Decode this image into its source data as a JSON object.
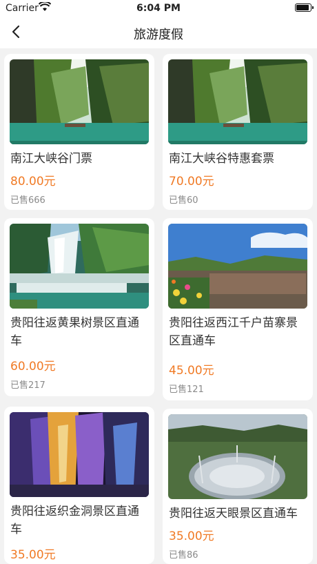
{
  "status_bar": {
    "carrier": "Carrier",
    "time": "6:04 PM",
    "battery_level": 0.9
  },
  "nav": {
    "title": "旅游度假",
    "back_icon": "chevron-left-icon"
  },
  "products": [
    {
      "title": "南江大峡谷门票",
      "price": "80.00元",
      "sold": "已售666"
    },
    {
      "title": "南江大峡谷特惠套票",
      "price": "70.00元",
      "sold": "已售60"
    },
    {
      "title": "贵阳往返黄果树景区直通车",
      "price": "60.00元",
      "sold": "已售217"
    },
    {
      "title": "贵阳往返西江千户苗寨景区直通车",
      "price": "45.00元",
      "sold": "已售121"
    },
    {
      "title": "贵阳往返织金洞景区直通车",
      "price": "35.00元",
      "sold": ""
    },
    {
      "title": "贵阳往返天眼景区直通车",
      "price": "35.00元",
      "sold": "已售86"
    }
  ]
}
